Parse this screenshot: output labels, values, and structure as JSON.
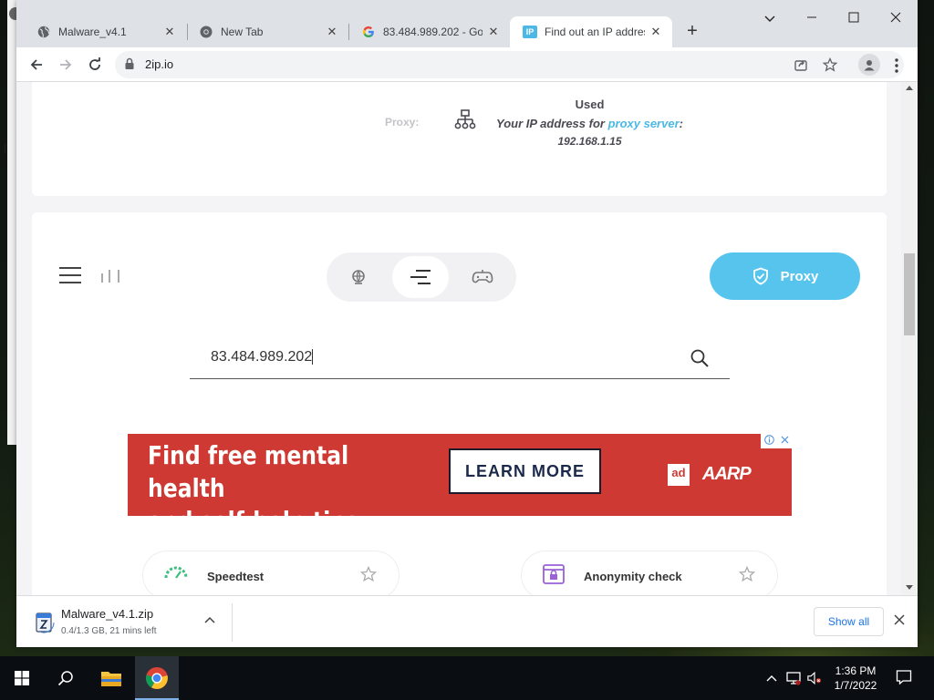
{
  "window": {
    "tabs": [
      {
        "label": "Malware_v4.1",
        "favicon": "globe-icon",
        "active": false
      },
      {
        "label": "New Tab",
        "favicon": "chrome-icon",
        "active": false
      },
      {
        "label": "83.484.989.202 - Goo",
        "favicon": "google-icon",
        "active": false
      },
      {
        "label": "Find out an IP addres",
        "favicon": "ip-favicon",
        "active": true
      }
    ],
    "favicon_ip_text": "IP",
    "new_tab_symbol": "+",
    "close_symbol": "✕",
    "controls": {
      "chevron": "⌄",
      "minimize": "—",
      "maximize": "☐",
      "close": "✕"
    }
  },
  "toolbar": {
    "url": "2ip.io"
  },
  "page": {
    "proxy_card": {
      "label": "Proxy:",
      "status": "Used",
      "ip_prefix": "Your IP address for ",
      "ip_link": "proxy server",
      "ip_suffix": ":",
      "ip_value": "192.168.1.15"
    },
    "proxy_button": "Proxy",
    "search": {
      "value": "83.484.989.202"
    },
    "ad": {
      "line1": "Find free mental health",
      "line2": "and self-help tips",
      "cta": "LEARN MORE",
      "ad_council": "ad",
      "brand": "AARP"
    },
    "tiles": [
      {
        "label": "Speedtest",
        "icon": "speedometer-icon"
      },
      {
        "label": "Anonymity check",
        "icon": "lock-window-icon"
      }
    ]
  },
  "download": {
    "filename": "Malware_v4.1.zip",
    "status": "0.4/1.3 GB, 21 mins left",
    "show_all": "Show all",
    "close": "✕"
  },
  "taskbar": {
    "time": "1:36 PM",
    "date": "1/7/2022"
  },
  "colors": {
    "accent": "#57c4ee",
    "link": "#4bb8e6",
    "ad_red": "#ce3a33"
  }
}
